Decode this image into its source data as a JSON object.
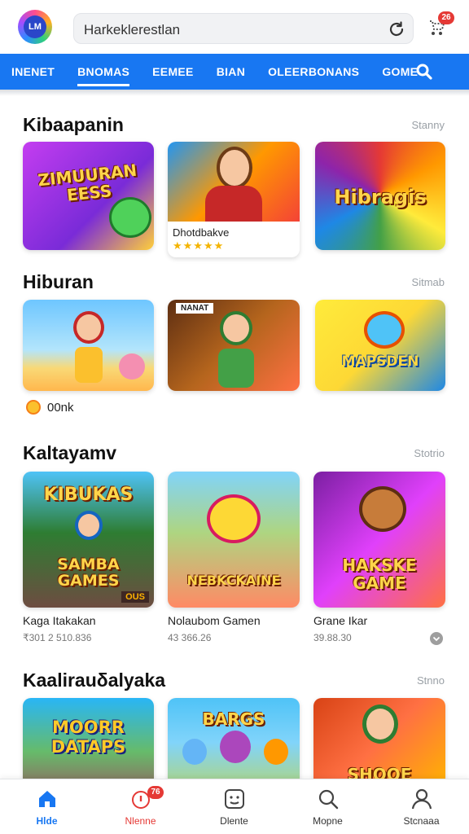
{
  "header": {
    "logo_text": "LM",
    "search_value": "Harkeklerestlan",
    "cart_badge": "26"
  },
  "colors": {
    "primary": "#1877f2",
    "badge": "#e53935",
    "star": "#f4b400"
  },
  "category_tabs": [
    {
      "label": "INENET",
      "active": false
    },
    {
      "label": "BNOMAS",
      "active": true
    },
    {
      "label": "EEMEE",
      "active": false
    },
    {
      "label": "BIAN",
      "active": false
    },
    {
      "label": "OLEERBONANS",
      "active": false
    },
    {
      "label": "GOME",
      "active": false
    }
  ],
  "sections": [
    {
      "title": "Kibaapanin",
      "more": "Stanny",
      "cards": [
        {
          "art_text": "ZIMUURAN\nEESS",
          "name": "",
          "sub": ""
        },
        {
          "art_text": "",
          "name": "Dhotdbakve",
          "stars": "★★★★★"
        },
        {
          "art_text": "Hibragis",
          "name": "",
          "sub": ""
        }
      ]
    },
    {
      "title": "Hiburan",
      "more": "Sitmab",
      "cards": [
        {
          "art_text": "",
          "name": ""
        },
        {
          "art_text": "",
          "name": "",
          "tag": "NANAT"
        },
        {
          "art_text": "MAPSDEN",
          "name": ""
        }
      ],
      "coin_label": "00nk"
    },
    {
      "title": "Kaltayamv",
      "more": "Stotrio",
      "cards": [
        {
          "art_text": "KIBUKAS",
          "art_text2": "SAMBA\nGAMES",
          "corner": "OUS",
          "name": "Kaga Itakakan",
          "sub": "₹301 2 510.836"
        },
        {
          "art_text": "NEBKCKAINE",
          "name": "Nolaubom Gamen",
          "sub": "43 366.26"
        },
        {
          "art_text": "HAKSKE\nGAME",
          "name": "Grane Ikar",
          "sub": "39.88.30"
        }
      ]
    },
    {
      "title": "Kaalirauδalyaka",
      "more": "Stnno",
      "cards": [
        {
          "art_text": "MOORR\nDATAPS",
          "name": ""
        },
        {
          "art_text": "BARGS",
          "name": ""
        },
        {
          "art_text": "SHOOE",
          "name": ""
        }
      ]
    }
  ],
  "bottom_nav": [
    {
      "label": "Hlde",
      "icon": "home-icon",
      "active": true
    },
    {
      "label": "Nlenne",
      "icon": "notification-icon",
      "badge": "76",
      "active": false
    },
    {
      "label": "Dlente",
      "icon": "games-icon",
      "active": false
    },
    {
      "label": "Mopne",
      "icon": "search-icon",
      "active": false
    },
    {
      "label": "Stcnaaa",
      "icon": "profile-icon",
      "active": false
    }
  ]
}
